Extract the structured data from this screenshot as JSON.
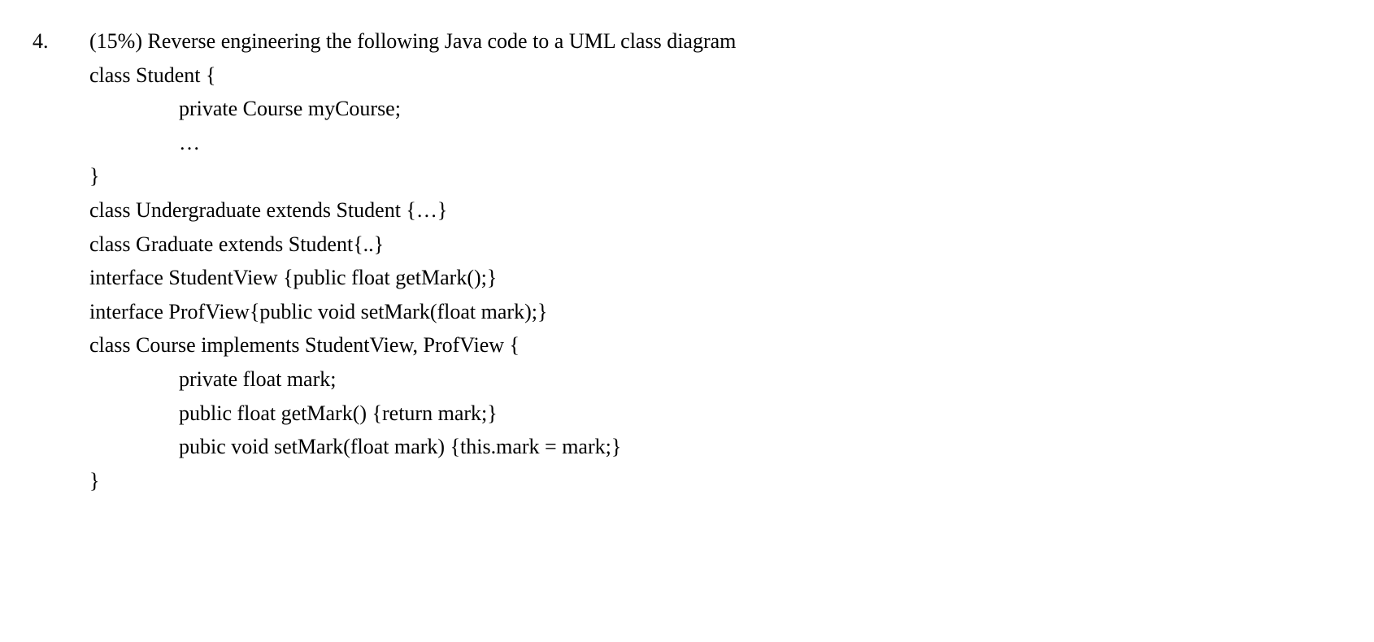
{
  "question": {
    "number": "4.",
    "prompt": "(15%) Reverse engineering the following Java code to a UML class diagram",
    "code_lines": [
      {
        "indent": 0,
        "text": "class Student {"
      },
      {
        "indent": 1,
        "text": "private Course myCourse;"
      },
      {
        "indent": 1,
        "text": "…"
      },
      {
        "indent": 0,
        "text": "}"
      },
      {
        "indent": 0,
        "text": "class Undergraduate extends Student {…}"
      },
      {
        "indent": 0,
        "text": "class Graduate extends Student{..}"
      },
      {
        "indent": 0,
        "text": "interface StudentView {public float getMark();}"
      },
      {
        "indent": 0,
        "text": "interface ProfView{public void setMark(float mark);}"
      },
      {
        "indent": 0,
        "text": "class Course implements StudentView, ProfView {"
      },
      {
        "indent": 1,
        "text": "private float mark;"
      },
      {
        "indent": 1,
        "text": "public float getMark() {return mark;}"
      },
      {
        "indent": 1,
        "text": "pubic void setMark(float mark) {this.mark = mark;}"
      },
      {
        "indent": 0,
        "text": "}"
      }
    ]
  }
}
